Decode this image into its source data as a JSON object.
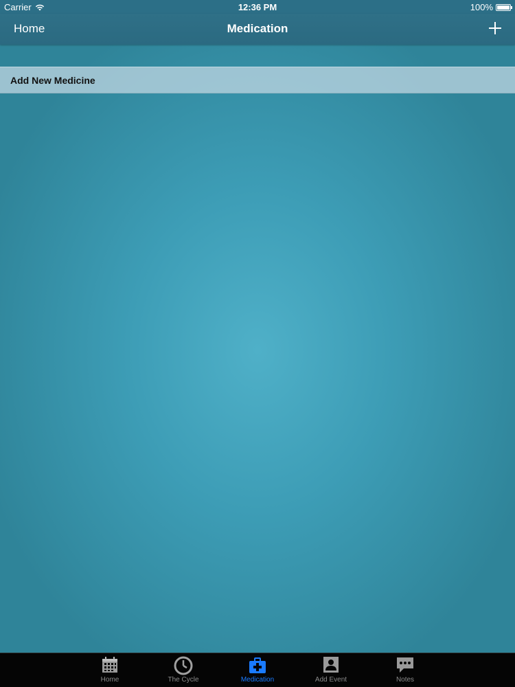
{
  "status_bar": {
    "carrier": "Carrier",
    "time": "12:36 PM",
    "battery": "100%"
  },
  "nav": {
    "back_label": "Home",
    "title": "Medication",
    "add_icon": "plus-icon"
  },
  "list": {
    "add_row_label": "Add New Medicine"
  },
  "tabs": [
    {
      "label": "Home",
      "icon": "calendar-icon",
      "active": false
    },
    {
      "label": "The Cycle",
      "icon": "clock-icon",
      "active": false
    },
    {
      "label": "Medication",
      "icon": "medkit-icon",
      "active": true
    },
    {
      "label": "Add Event",
      "icon": "contact-icon",
      "active": false
    },
    {
      "label": "Notes",
      "icon": "speech-bubble-icon",
      "active": false
    }
  ],
  "colors": {
    "accent": "#1a7bff",
    "nav_bg": "#2c6f87",
    "background_center": "#4fb0c8",
    "background_edge": "#2f8499",
    "tab_inactive": "#8a8a8a"
  }
}
